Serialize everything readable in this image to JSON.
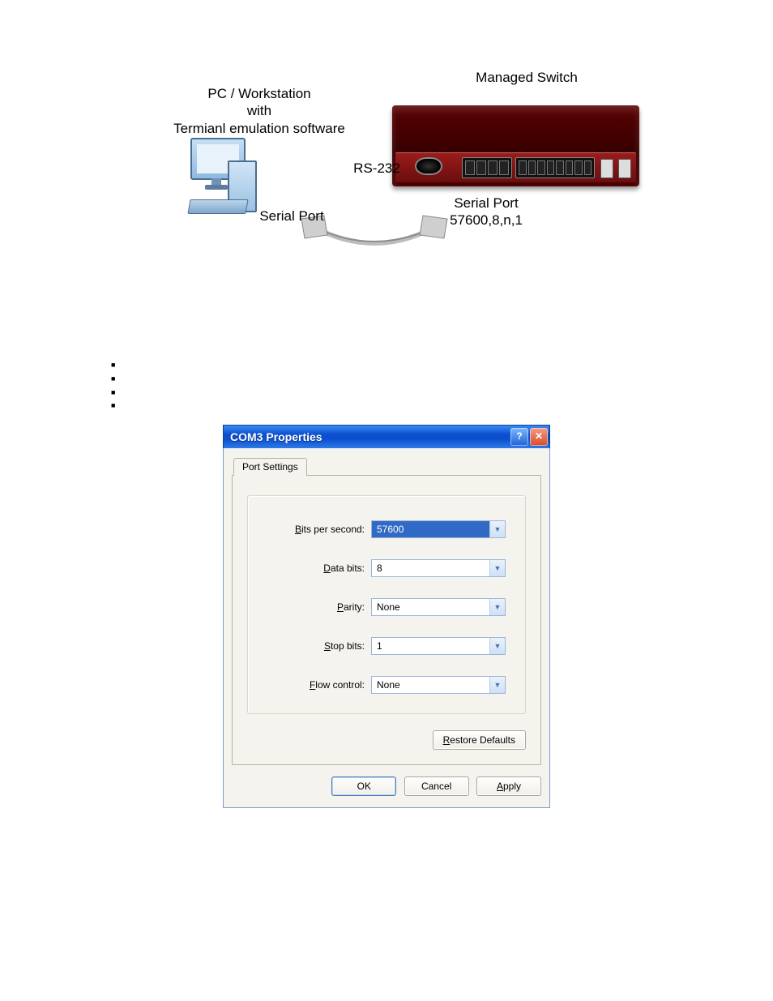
{
  "diagram": {
    "pc_label_line1": "PC / Workstation",
    "pc_label_line2": "with",
    "pc_label_line3": "Termianl emulation software",
    "switch_label": "Managed Switch",
    "cable_label": "RS-232",
    "pc_port_label": "Serial Port",
    "switch_port_label": "Serial Port",
    "switch_port_params": "57600,8,n,1"
  },
  "dialog": {
    "title": "COM3 Properties",
    "tab": "Port Settings",
    "fields": {
      "baud": {
        "label_pre": "B",
        "label_post": "its per second:",
        "value": "57600"
      },
      "data": {
        "label_pre": "D",
        "label_post": "ata bits:",
        "value": "8"
      },
      "parity": {
        "label_pre": "P",
        "label_post": "arity:",
        "value": "None"
      },
      "stop": {
        "label_pre": "S",
        "label_post": "top bits:",
        "value": "1"
      },
      "flow": {
        "label_pre": "F",
        "label_post": "low control:",
        "value": "None"
      }
    },
    "restore_pre": "R",
    "restore_post": "estore Defaults",
    "ok": "OK",
    "cancel": "Cancel",
    "apply_pre": "A",
    "apply_post": "pply",
    "help_icon": "?",
    "close_icon": "✕"
  }
}
